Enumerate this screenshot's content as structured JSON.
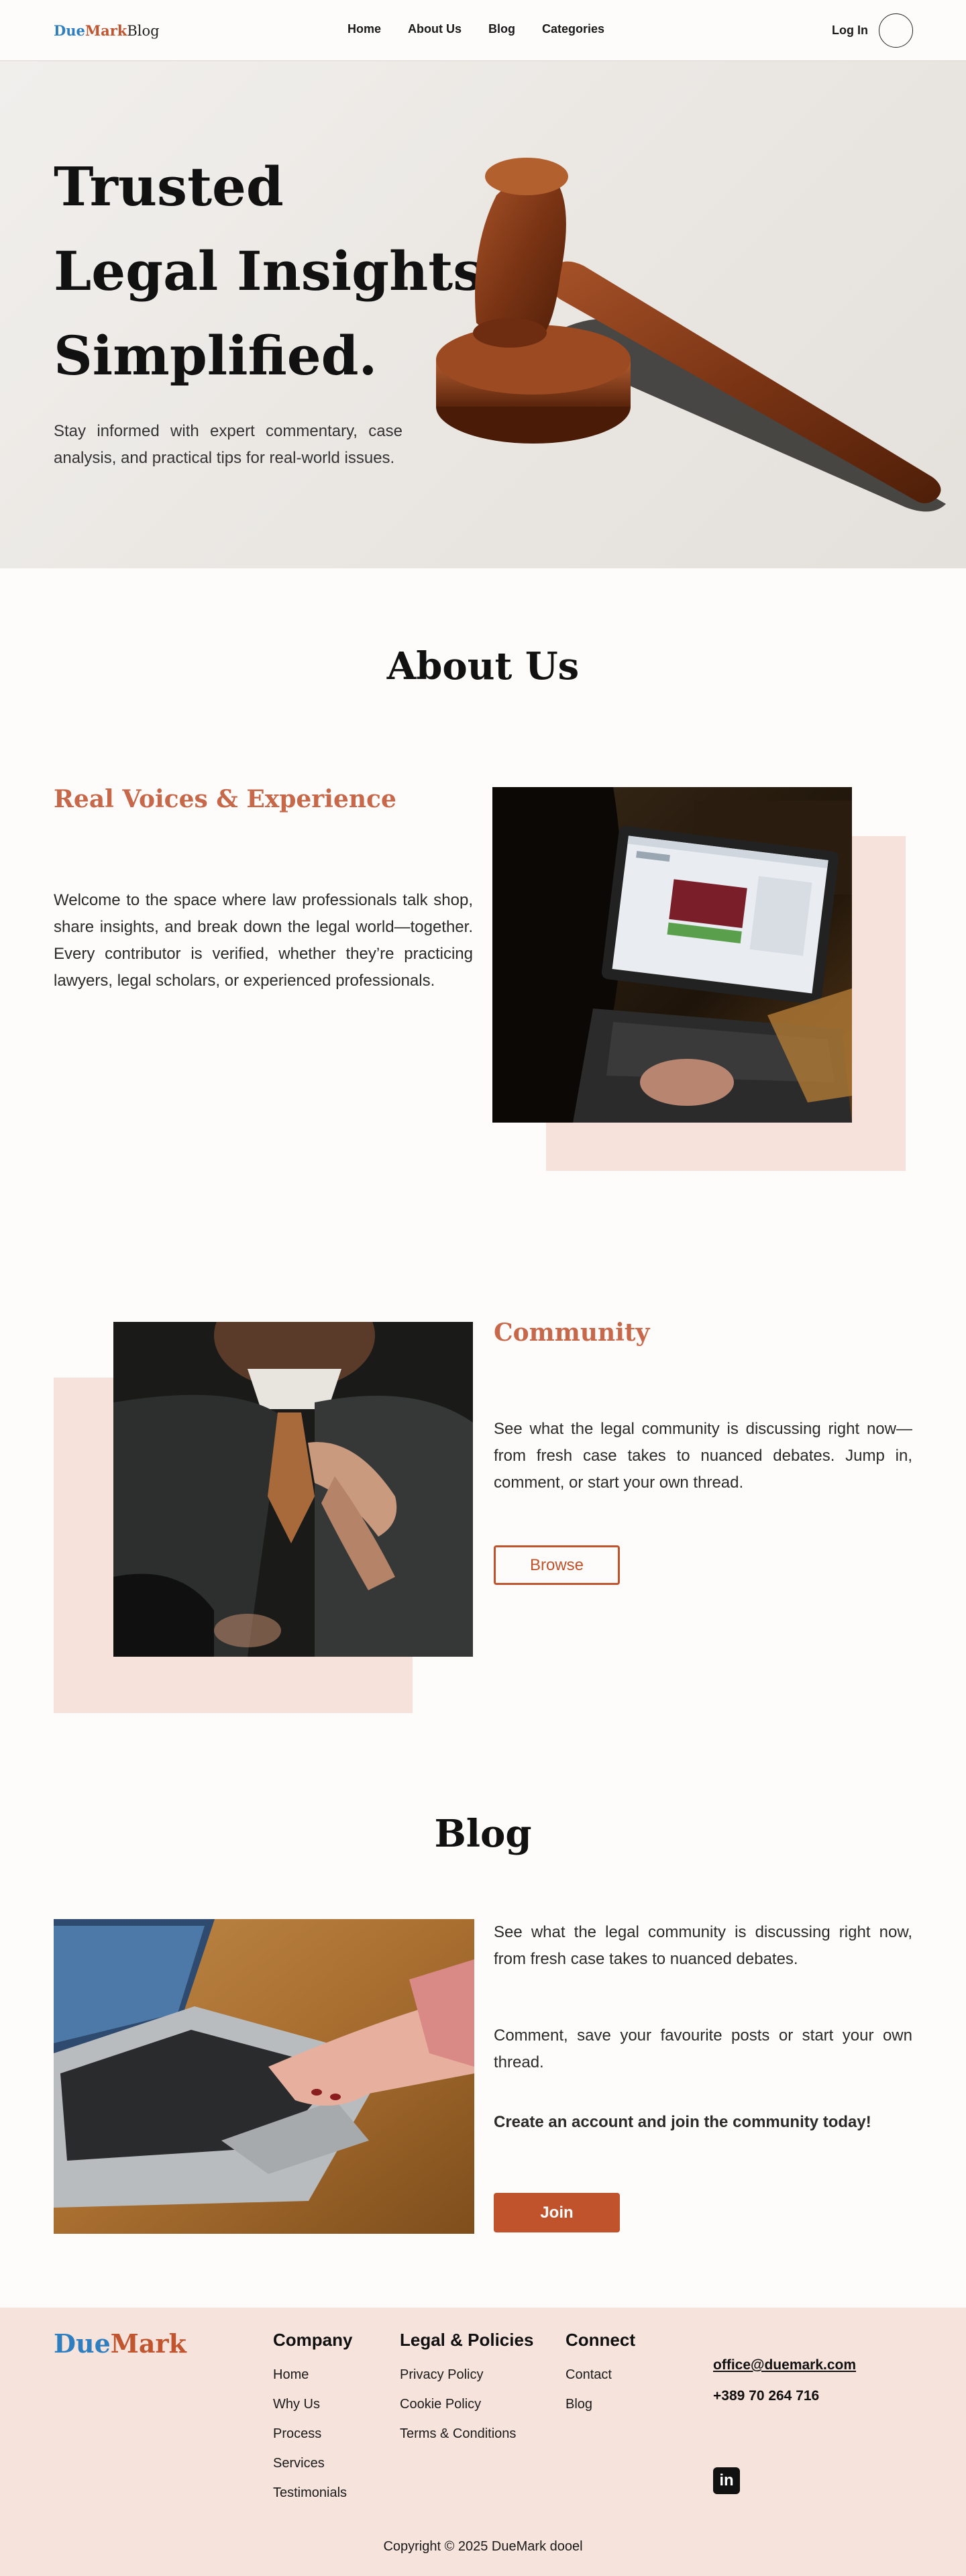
{
  "header": {
    "logo": {
      "part1": "Due",
      "part2": "Mark",
      "part3": "Blog"
    },
    "nav": [
      "Home",
      "About Us",
      "Blog",
      "Categories"
    ],
    "login": "Log In"
  },
  "hero": {
    "title_line1": "Trusted",
    "title_line2": "Legal Insights,",
    "title_line3": "Simplified.",
    "subtitle": "Stay informed with expert commentary, case analysis, and practical tips for real-world issues."
  },
  "about": {
    "title": "About Us",
    "voices": {
      "heading": "Real Voices & Experience",
      "text": "Welcome to the space where law professionals talk shop, share insights, and break down the legal world—together. Every contributor is verified, whether they’re practicing lawyers, legal scholars, or experienced professionals."
    },
    "community": {
      "heading": "Community",
      "text": "See what the legal community is discussing right now—from fresh case takes to nuanced debates. Jump in, comment, or start your own thread.",
      "button": "Browse"
    }
  },
  "blog": {
    "title": "Blog",
    "para1": "See what the legal community is discussing right now, from fresh case takes to nuanced debates.",
    "para2": "Comment, save your favourite posts or start your own thread.",
    "cta": "Create an account and join the community today!",
    "button": "Join"
  },
  "footer": {
    "logo": {
      "part1": "Due",
      "part2": "Mark"
    },
    "company": {
      "heading": "Company",
      "links": [
        "Home",
        "Why Us",
        "Process",
        "Services",
        "Testimonials"
      ]
    },
    "legal": {
      "heading": "Legal & Policies",
      "links": [
        "Privacy Policy",
        "Cookie Policy",
        "Terms & Conditions"
      ]
    },
    "connect": {
      "heading": "Connect",
      "links": [
        "Contact",
        "Blog"
      ]
    },
    "email": "office@duemark.com",
    "phone": "+389 70 264 716",
    "social_icon": "linkedin-icon",
    "social_label": "in",
    "copyright": "Copyright © 2025 DueMark dooel"
  },
  "colors": {
    "accent": "#c0532c",
    "heading_accent": "#c8684a",
    "brand_blue": "#2f7fc0",
    "footer_bg": "#f5e3dc"
  }
}
